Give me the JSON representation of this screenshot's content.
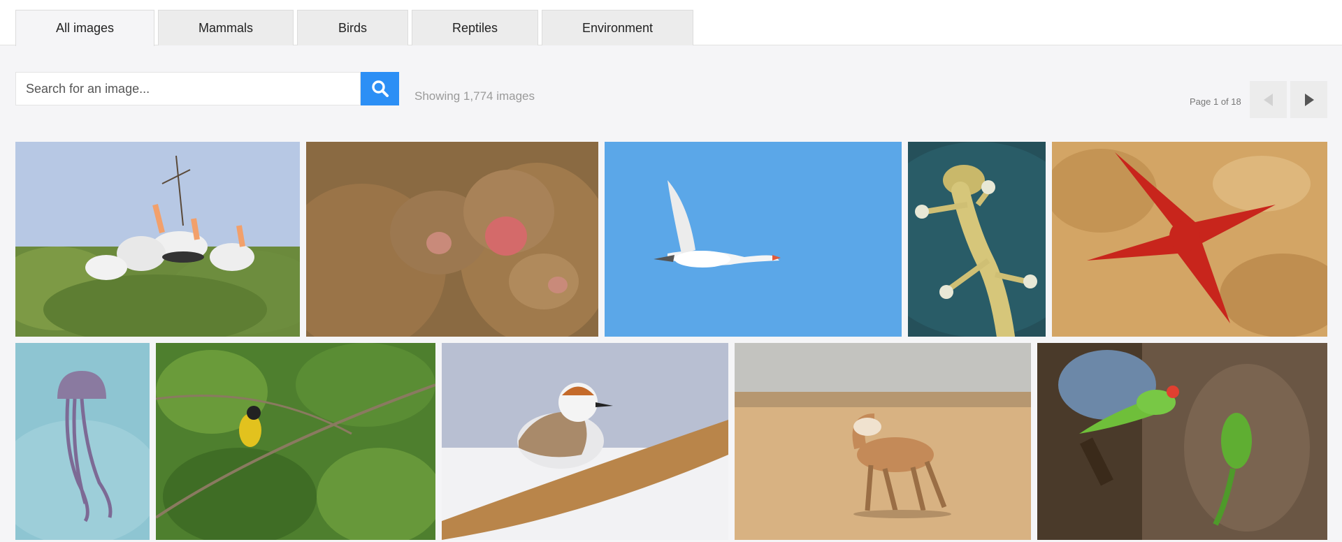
{
  "tabs": [
    {
      "label": "All images",
      "active": true
    },
    {
      "label": "Mammals",
      "active": false
    },
    {
      "label": "Birds",
      "active": false
    },
    {
      "label": "Reptiles",
      "active": false
    },
    {
      "label": "Environment",
      "active": false
    }
  ],
  "search": {
    "placeholder": "Search for an image...",
    "value": "",
    "button_icon": "search-icon"
  },
  "results": {
    "count_text": "Showing 1,774 images"
  },
  "pagination": {
    "page_text": "Page 1 of 18",
    "current_page": 1,
    "total_pages": 18,
    "prev_icon": "chevron-left-icon",
    "next_icon": "chevron-right-icon"
  },
  "gallery": {
    "images": [
      {
        "subject": "painted storks in tree"
      },
      {
        "subject": "macaque monkeys huddled"
      },
      {
        "subject": "swan in flight"
      },
      {
        "subject": "gecko on glass"
      },
      {
        "subject": "red starfish on rock"
      },
      {
        "subject": "jellyfish"
      },
      {
        "subject": "yellow bird in leaves"
      },
      {
        "subject": "plover on snow"
      },
      {
        "subject": "wild ass in desert"
      },
      {
        "subject": "parakeets on tree trunk"
      }
    ]
  },
  "colors": {
    "accent": "#2c8ff5",
    "background": "#f5f5f7",
    "tab_inactive": "#ececec"
  }
}
